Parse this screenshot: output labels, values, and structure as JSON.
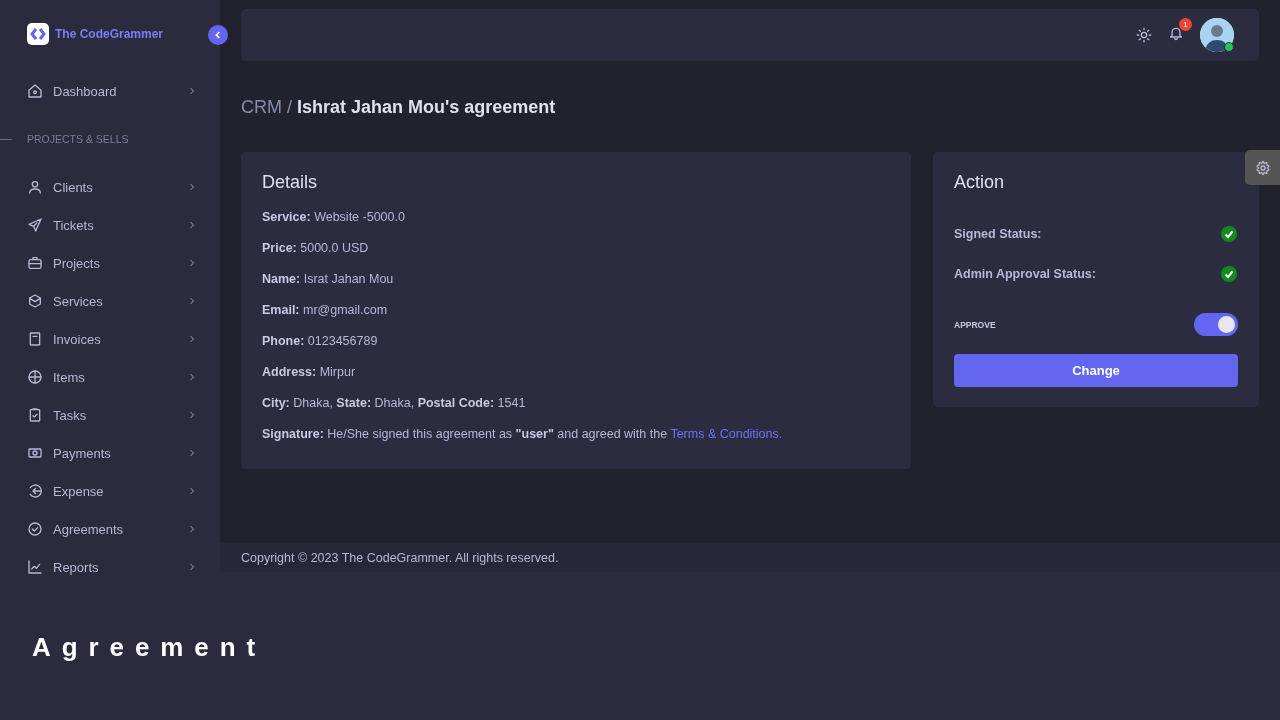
{
  "sidebar": {
    "brand": "The CodeGrammer",
    "top_items": [
      {
        "label": "Dashboard"
      }
    ],
    "section": "PROJECTS & SELLS",
    "items": [
      {
        "label": "Clients"
      },
      {
        "label": "Tickets"
      },
      {
        "label": "Projects"
      },
      {
        "label": "Services"
      },
      {
        "label": "Invoices"
      },
      {
        "label": "Items"
      },
      {
        "label": "Tasks"
      },
      {
        "label": "Payments"
      },
      {
        "label": "Expense"
      },
      {
        "label": "Agreements"
      },
      {
        "label": "Reports"
      }
    ]
  },
  "header": {
    "notification_count": "1",
    "user_online": true
  },
  "breadcrumb": {
    "parent": "CRM /",
    "current": "Ishrat Jahan Mou's agreement"
  },
  "details": {
    "title": "Details",
    "lines": [
      "**Service:** Website -5000.0",
      "**Price:** 5000.0 USD",
      "**Name:** Israt Jahan Mou",
      "**Email:** mr@gmail.com",
      "**Phone:** 0123456789",
      "**Address:** Mirpur",
      "**City:** Dhaka, **State:** Dhaka, **Postal Code:** 1541"
    ],
    "signature": {
      "text": "**Signature:** He/She signed this agreement as **\"user\"** and agreed with the",
      "link": "Terms & Conditions."
    }
  },
  "action": {
    "title": "Action",
    "statuses": [
      {
        "label": "Signed Status:",
        "checked": true
      },
      {
        "label": "Admin Approval Status:",
        "checked": true
      }
    ],
    "toggle": {
      "label": "APPROVE",
      "on": true
    },
    "button": "Change"
  },
  "footer": "Copyright © 2023 The CodeGrammer. All rights reserved.",
  "caption": "Agreement"
}
